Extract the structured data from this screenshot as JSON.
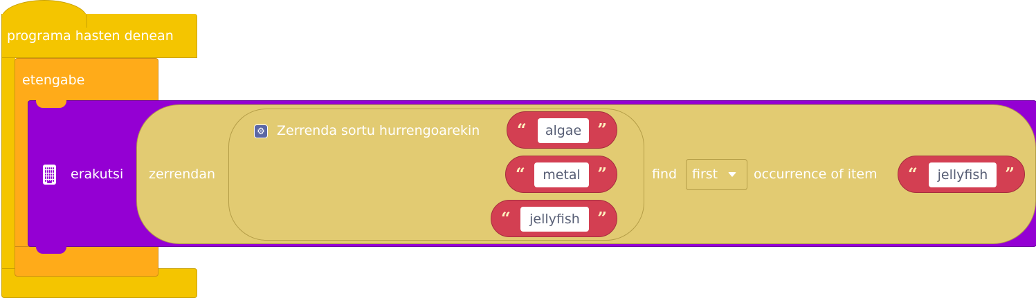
{
  "event_block": {
    "label": "programa hasten denean",
    "color": "#f4c500"
  },
  "loop_block": {
    "label": "etengabe",
    "color": "#ffab19"
  },
  "show_block": {
    "label": "erakutsi",
    "icon": "led-grid-icon",
    "color": "#9400d3"
  },
  "find_block": {
    "prefix_label": "zerrendan",
    "find_label": "find",
    "mode_value": "first",
    "occurrence_label": "occurrence of item",
    "color": "#e2cb72"
  },
  "create_list_block": {
    "label": "Zerrenda sortu hurrengoarekin",
    "icon": "gear-icon",
    "items": [
      {
        "value": "algae"
      },
      {
        "value": "metal"
      },
      {
        "value": "jellyfish"
      }
    ]
  },
  "search_item": {
    "value": "jellyfish"
  },
  "string_block": {
    "open_quote": "“",
    "close_quote": "”",
    "color": "#d33f52"
  }
}
